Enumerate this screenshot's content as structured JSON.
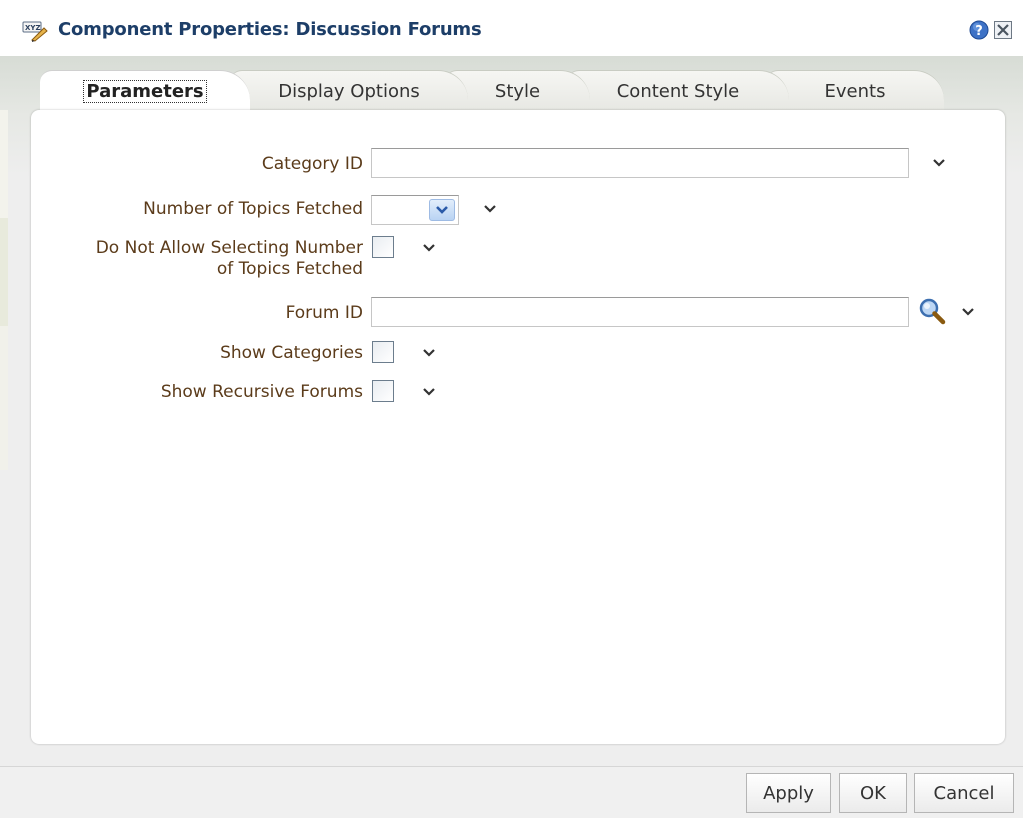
{
  "dialog": {
    "title": "Component Properties: Discussion Forums",
    "icons": {
      "title": "xyz-edit-icon",
      "help": "help-icon",
      "close": "close-icon"
    }
  },
  "tabs": [
    {
      "label": "Parameters",
      "active": true
    },
    {
      "label": "Display Options",
      "active": false
    },
    {
      "label": "Style",
      "active": false
    },
    {
      "label": "Content Style",
      "active": false
    },
    {
      "label": "Events",
      "active": false
    }
  ],
  "form": {
    "category_id": {
      "label": "Category ID",
      "value": ""
    },
    "topics_fetched": {
      "label": "Number of Topics Fetched",
      "value": ""
    },
    "no_select_topics": {
      "label_line1": "Do Not Allow Selecting Number",
      "label_line2": "of Topics Fetched",
      "checked": false
    },
    "forum_id": {
      "label": "Forum ID",
      "value": ""
    },
    "show_categories": {
      "label": "Show Categories",
      "checked": false
    },
    "show_recursive": {
      "label": "Show Recursive Forums",
      "checked": false
    }
  },
  "buttons": {
    "apply": "Apply",
    "ok": "OK",
    "cancel": "Cancel"
  },
  "colors": {
    "title": "#1d3e68",
    "label": "#5b3b1a",
    "panel": "#ffffff",
    "band": "#eeeeee"
  }
}
